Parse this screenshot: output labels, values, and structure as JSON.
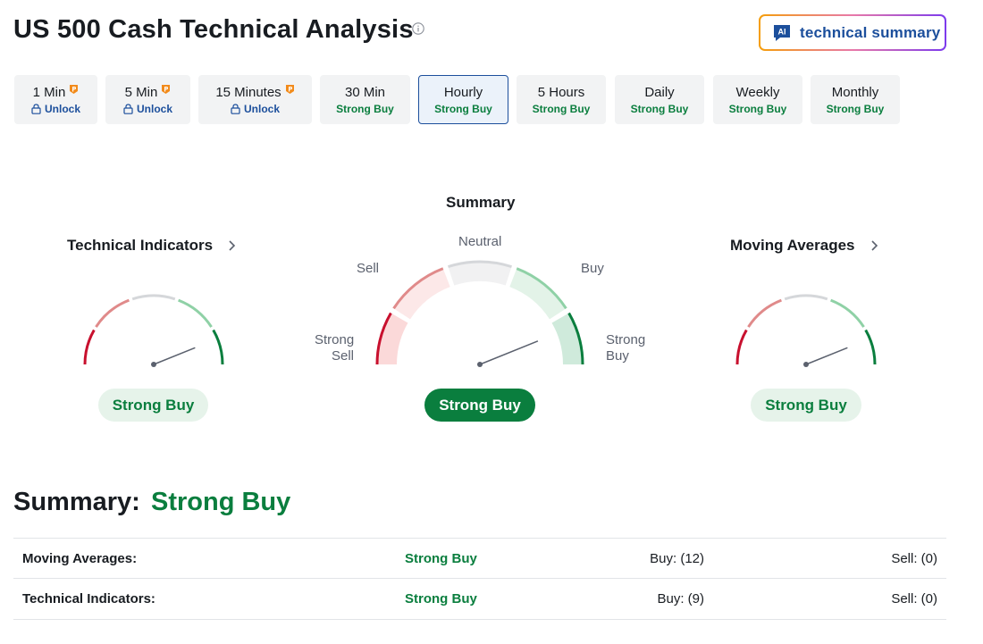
{
  "header": {
    "title": "US 500 Cash Technical Analysis",
    "ai_button_label": "technical summary",
    "ai_badge": "AI"
  },
  "tabs": [
    {
      "name": "1 Min",
      "status": "Unlock",
      "locked": true,
      "active": false
    },
    {
      "name": "5 Min",
      "status": "Unlock",
      "locked": true,
      "active": false
    },
    {
      "name": "15 Minutes",
      "status": "Unlock",
      "locked": true,
      "active": false
    },
    {
      "name": "30 Min",
      "status": "Strong Buy",
      "locked": false,
      "active": false
    },
    {
      "name": "Hourly",
      "status": "Strong Buy",
      "locked": false,
      "active": true
    },
    {
      "name": "5 Hours",
      "status": "Strong Buy",
      "locked": false,
      "active": false
    },
    {
      "name": "Daily",
      "status": "Strong Buy",
      "locked": false,
      "active": false
    },
    {
      "name": "Weekly",
      "status": "Strong Buy",
      "locked": false,
      "active": false
    },
    {
      "name": "Monthly",
      "status": "Strong Buy",
      "locked": false,
      "active": false
    }
  ],
  "gauges": {
    "technical_indicators": {
      "title": "Technical Indicators",
      "result": "Strong Buy",
      "level": "Strong Buy"
    },
    "summary": {
      "title": "Summary",
      "result": "Strong Buy",
      "level": "Strong Buy",
      "labels": {
        "strong_sell_1": "Strong",
        "strong_sell_2": "Sell",
        "sell": "Sell",
        "neutral": "Neutral",
        "buy": "Buy",
        "strong_buy_1": "Strong",
        "strong_buy_2": "Buy"
      }
    },
    "moving_averages": {
      "title": "Moving Averages",
      "result": "Strong Buy",
      "level": "Strong Buy"
    }
  },
  "summary": {
    "heading": "Summary:",
    "value": "Strong Buy",
    "rows": [
      {
        "label": "Moving Averages:",
        "signal": "Strong Buy",
        "buy": "Buy: (12)",
        "sell": "Sell: (0)"
      },
      {
        "label": "Technical Indicators:",
        "signal": "Strong Buy",
        "buy": "Buy: (9)",
        "sell": "Sell: (0)"
      }
    ]
  },
  "colors": {
    "strong_buy": "#0a7e3e",
    "buy": "#8fd1a6",
    "neutral": "#d5d7da",
    "sell": "#e08a8a",
    "strong_sell": "#c8102e",
    "link_blue": "#1c4f9c",
    "pro_orange": "#f28b1b"
  }
}
